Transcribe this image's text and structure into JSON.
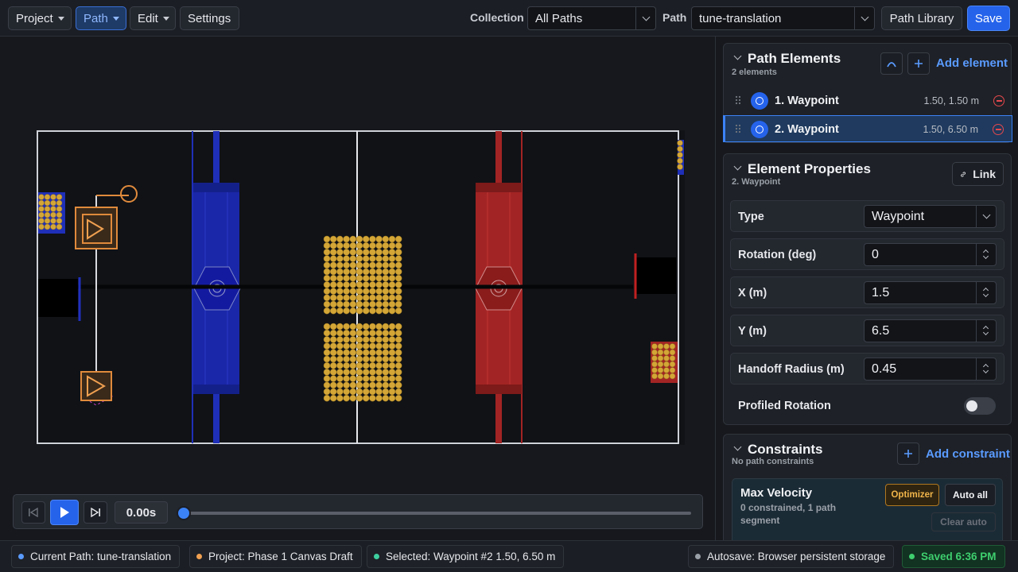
{
  "menu": {
    "project": "Project",
    "path": "Path",
    "edit": "Edit",
    "settings": "Settings"
  },
  "toolbar": {
    "collection_label": "Collection",
    "collection_value": "All Paths",
    "path_label": "Path",
    "path_value": "tune-translation",
    "path_library": "Path Library",
    "save": "Save"
  },
  "playback": {
    "time": "0.00s",
    "progress": 0
  },
  "path_elements": {
    "title": "Path Elements",
    "count": "2 elements",
    "add_label": "Add element",
    "items": [
      {
        "name": "1. Waypoint",
        "coords": "1.50, 1.50 m"
      },
      {
        "name": "2. Waypoint",
        "coords": "1.50, 6.50 m"
      }
    ]
  },
  "element_properties": {
    "title": "Element Properties",
    "subtitle": "2. Waypoint",
    "link_label": "Link",
    "type_label": "Type",
    "type_value": "Waypoint",
    "rotation_label": "Rotation (deg)",
    "rotation_value": "0",
    "x_label": "X (m)",
    "x_value": "1.5",
    "y_label": "Y (m)",
    "y_value": "6.5",
    "handoff_label": "Handoff Radius (m)",
    "handoff_value": "0.45",
    "profiled_label": "Profiled Rotation",
    "profiled_on": false
  },
  "constraints": {
    "title": "Constraints",
    "subtitle": "No path constraints",
    "add_label": "Add constraint",
    "max_velocity": {
      "title": "Max Velocity",
      "desc": "0 constrained, 1 path segment",
      "optimizer": "Optimizer",
      "auto_all": "Auto all",
      "clear_auto": "Clear auto"
    }
  },
  "status": {
    "current_path": "Current Path: tune-translation",
    "project": "Project: Phase 1 Canvas Draft",
    "selected": "Selected: Waypoint #2 1.50, 6.50 m",
    "autosave": "Autosave: Browser persistent storage",
    "saved": "Saved 6:36 PM"
  },
  "colors": {
    "accent": "#2563eb",
    "blue_alliance": "#1f2fb8",
    "red_alliance": "#a32424",
    "fuel": "#d4a636",
    "robot": "#e08a3c",
    "saved": "#3ecf6e"
  }
}
